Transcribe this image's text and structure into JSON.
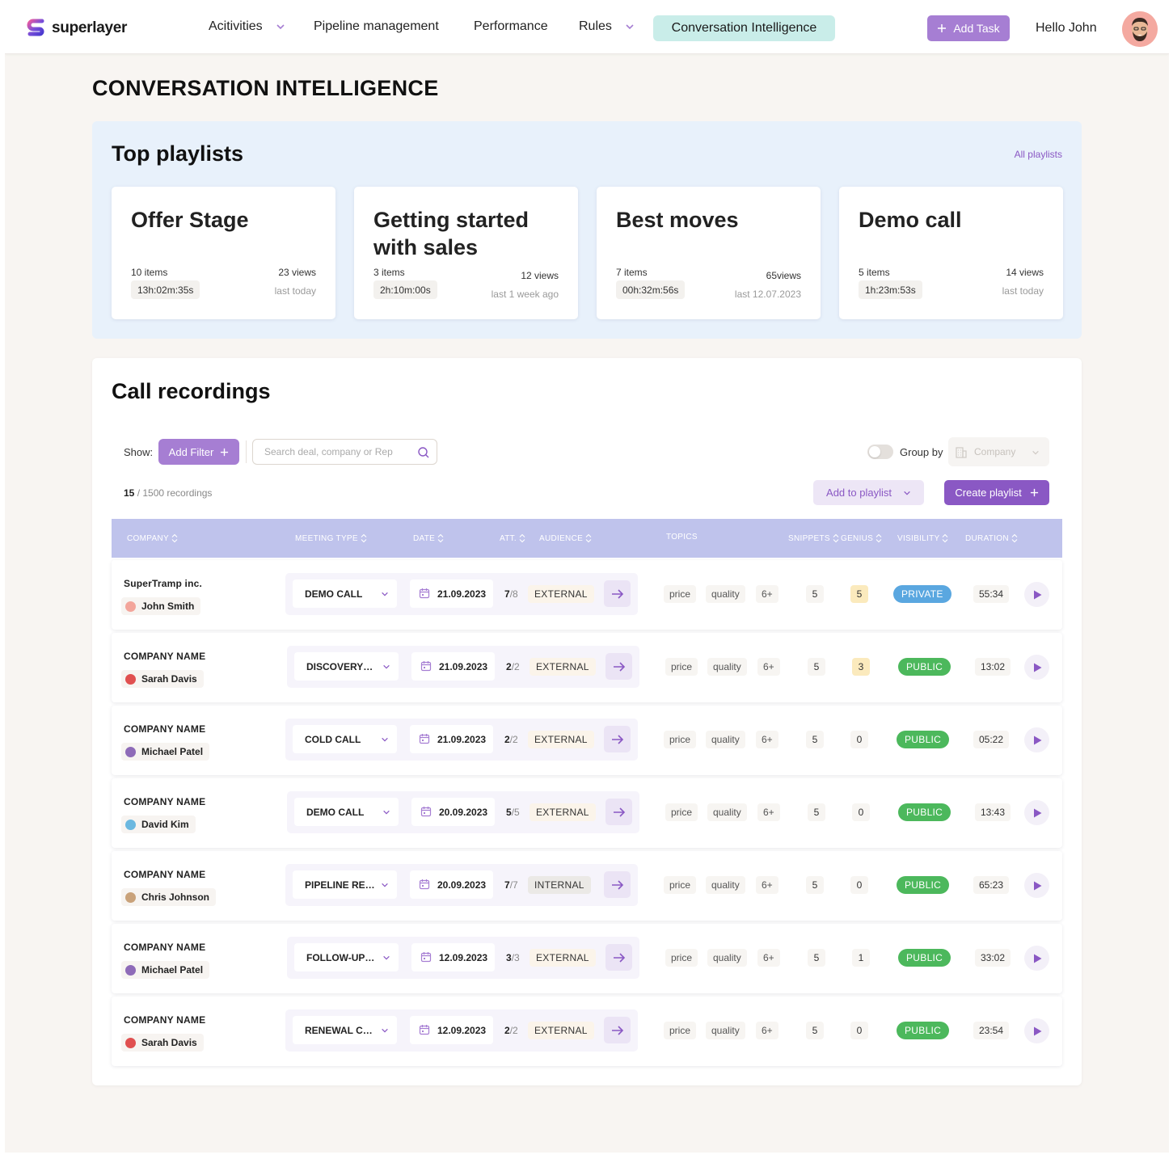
{
  "brand": {
    "name": "superlayer"
  },
  "nav": {
    "items": [
      {
        "label": "Acitivities",
        "has_dropdown": true
      },
      {
        "label": "Pipeline management",
        "has_dropdown": false
      },
      {
        "label": "Performance",
        "has_dropdown": false
      },
      {
        "label": "Rules",
        "has_dropdown": true
      }
    ],
    "active": "Conversation Intelligence",
    "add_task": "Add Task",
    "greeting": "Hello John"
  },
  "page_title": "CONVERSATION INTELLIGENCE",
  "playlists": {
    "title": "Top playlists",
    "all_link": "All playlists",
    "cards": [
      {
        "title": "Offer Stage",
        "items": "10 items",
        "views": "23 views",
        "duration": "13h:02m:35s",
        "last": "last today"
      },
      {
        "title": "Getting started with sales",
        "items": "3 items",
        "views": "12 views",
        "duration": "2h:10m:00s",
        "last": "last 1 week ago"
      },
      {
        "title": "Best moves",
        "items": "7 items",
        "views": "65views",
        "duration": "00h:32m:56s",
        "last": "last 12.07.2023"
      },
      {
        "title": "Demo call",
        "items": "5 items",
        "views": "14 views",
        "duration": "1h:23m:53s",
        "last": "last today"
      }
    ]
  },
  "recordings": {
    "title": "Call recordings",
    "show_label": "Show:",
    "add_filter": "Add Filter",
    "search_placeholder": "Search deal, company or Rep",
    "group_by_label": "Group by",
    "group_by_value": "Company",
    "count_shown": "15",
    "count_total": " / 1500 recordings",
    "add_to_playlist": "Add to playlist",
    "create_playlist": "Create playlist",
    "columns": {
      "company": "COMPANY",
      "meeting_type": "MEETING TYPE",
      "date": "DATE",
      "att": "ATT.",
      "audience": "AUDIENCE",
      "topics": "TOPICS",
      "snippets": "SNIPPETS",
      "genius": "GENIUS",
      "visibility": "VISIBILITY",
      "duration": "DURATION"
    },
    "rows": [
      {
        "company": "SuperTramp inc.",
        "person": "John Smith",
        "avatar_color": "#f3a59b",
        "meeting_type": "DEMO CALL",
        "date": "21.09.2023",
        "att_a": "7",
        "att_b": "/8",
        "audience": "EXTERNAL",
        "topics": [
          "price",
          "quality",
          "6+"
        ],
        "snippets": "5",
        "genius": "5",
        "genius_highlight": true,
        "visibility": "PRIVATE",
        "duration": "55:34"
      },
      {
        "company": "COMPANY NAME",
        "person": "Sarah Davis",
        "avatar_color": "#e05050",
        "meeting_type": "DISCOVERY…",
        "date": "21.09.2023",
        "att_a": "2",
        "att_b": "/2",
        "audience": "EXTERNAL",
        "topics": [
          "price",
          "quality",
          "6+"
        ],
        "snippets": "5",
        "genius": "3",
        "genius_highlight": true,
        "visibility": "PUBLIC",
        "duration": "13:02"
      },
      {
        "company": "COMPANY NAME",
        "person": "Michael Patel",
        "avatar_color": "#8e6bb8",
        "meeting_type": "COLD CALL",
        "date": "21.09.2023",
        "att_a": "2",
        "att_b": "/2",
        "audience": "EXTERNAL",
        "topics": [
          "price",
          "quality",
          "6+"
        ],
        "snippets": "5",
        "genius": "0",
        "genius_highlight": false,
        "visibility": "PUBLIC",
        "duration": "05:22"
      },
      {
        "company": "COMPANY NAME",
        "person": "David Kim",
        "avatar_color": "#6bb8e0",
        "meeting_type": "DEMO CALL",
        "date": "20.09.2023",
        "att_a": "5",
        "att_b": "/5",
        "audience": "EXTERNAL",
        "topics": [
          "price",
          "quality",
          "6+"
        ],
        "snippets": "5",
        "genius": "0",
        "genius_highlight": false,
        "visibility": "PUBLIC",
        "duration": "13:43"
      },
      {
        "company": "COMPANY NAME",
        "person": "Chris Johnson",
        "avatar_color": "#c9a27a",
        "meeting_type": "PIPELINE RE…",
        "date": "20.09.2023",
        "att_a": "7",
        "att_b": "/7",
        "audience": "INTERNAL",
        "topics": [
          "price",
          "quality",
          "6+"
        ],
        "snippets": "5",
        "genius": "0",
        "genius_highlight": false,
        "visibility": "PUBLIC",
        "duration": "65:23"
      },
      {
        "company": "COMPANY NAME",
        "person": "Michael Patel",
        "avatar_color": "#8e6bb8",
        "meeting_type": "FOLLOW-UP…",
        "date": "12.09.2023",
        "att_a": "3",
        "att_b": "/3",
        "audience": "EXTERNAL",
        "topics": [
          "price",
          "quality",
          "6+"
        ],
        "snippets": "5",
        "genius": "1",
        "genius_highlight": false,
        "visibility": "PUBLIC",
        "duration": "33:02"
      },
      {
        "company": "COMPANY NAME",
        "person": "Sarah Davis",
        "avatar_color": "#e05050",
        "meeting_type": "RENEWAL C…",
        "date": "12.09.2023",
        "att_a": "2",
        "att_b": "/2",
        "audience": "EXTERNAL",
        "topics": [
          "price",
          "quality",
          "6+"
        ],
        "snippets": "5",
        "genius": "0",
        "genius_highlight": false,
        "visibility": "PUBLIC",
        "duration": "23:54"
      }
    ]
  },
  "colors": {
    "accent": "#8a58c4",
    "accent_light": "#a67ed3",
    "active_nav": "#c9ede9",
    "table_header": "#bfc3ec",
    "public": "#4cb85c",
    "private": "#5aa7e0"
  },
  "icons": [
    "chevron-down-icon",
    "plus-icon",
    "search-icon",
    "calendar-icon",
    "arrow-right-icon",
    "play-icon",
    "sort-icon",
    "building-icon"
  ]
}
